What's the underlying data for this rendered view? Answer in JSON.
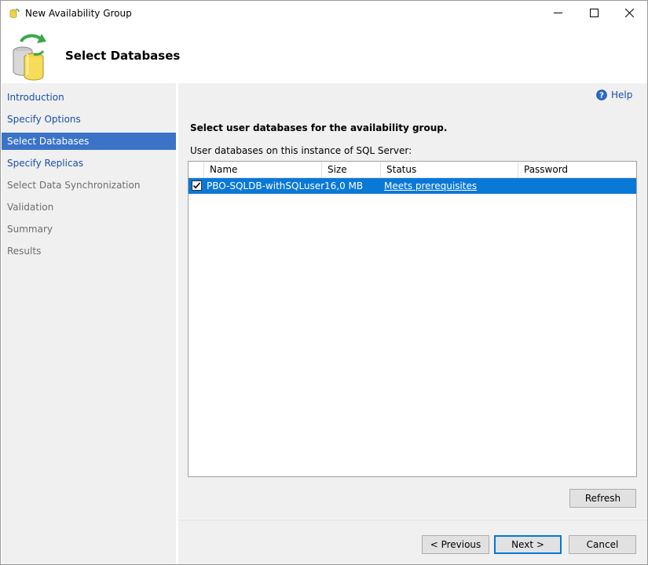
{
  "window": {
    "title": "New Availability Group",
    "controls": {
      "minimize": "—",
      "maximize": "☐",
      "close": "✕"
    }
  },
  "header": {
    "title": "Select Databases"
  },
  "nav": {
    "items": [
      {
        "label": "Introduction",
        "state": "link"
      },
      {
        "label": "Specify Options",
        "state": "link"
      },
      {
        "label": "Select Databases",
        "state": "active"
      },
      {
        "label": "Specify Replicas",
        "state": "link"
      },
      {
        "label": "Select Data Synchronization",
        "state": "disabled"
      },
      {
        "label": "Validation",
        "state": "disabled"
      },
      {
        "label": "Summary",
        "state": "disabled"
      },
      {
        "label": "Results",
        "state": "disabled"
      }
    ]
  },
  "main": {
    "help_label": "Help",
    "heading": "Select user databases for the availability group.",
    "grid_label": "User databases on this instance of SQL Server:",
    "columns": [
      "Name",
      "Size",
      "Status",
      "Password"
    ],
    "rows": [
      {
        "checked": true,
        "name": "PBO-SQLDB-withSQLuser",
        "size": "16,0 MB",
        "status": "Meets prerequisites",
        "password": ""
      }
    ],
    "refresh_label": "Refresh"
  },
  "footer": {
    "previous_label": "< Previous",
    "next_label": "Next >",
    "cancel_label": "Cancel"
  },
  "colors": {
    "nav_active": "#3a73c8",
    "row_selected": "#0a78d7",
    "link": "#1a4eaa"
  }
}
